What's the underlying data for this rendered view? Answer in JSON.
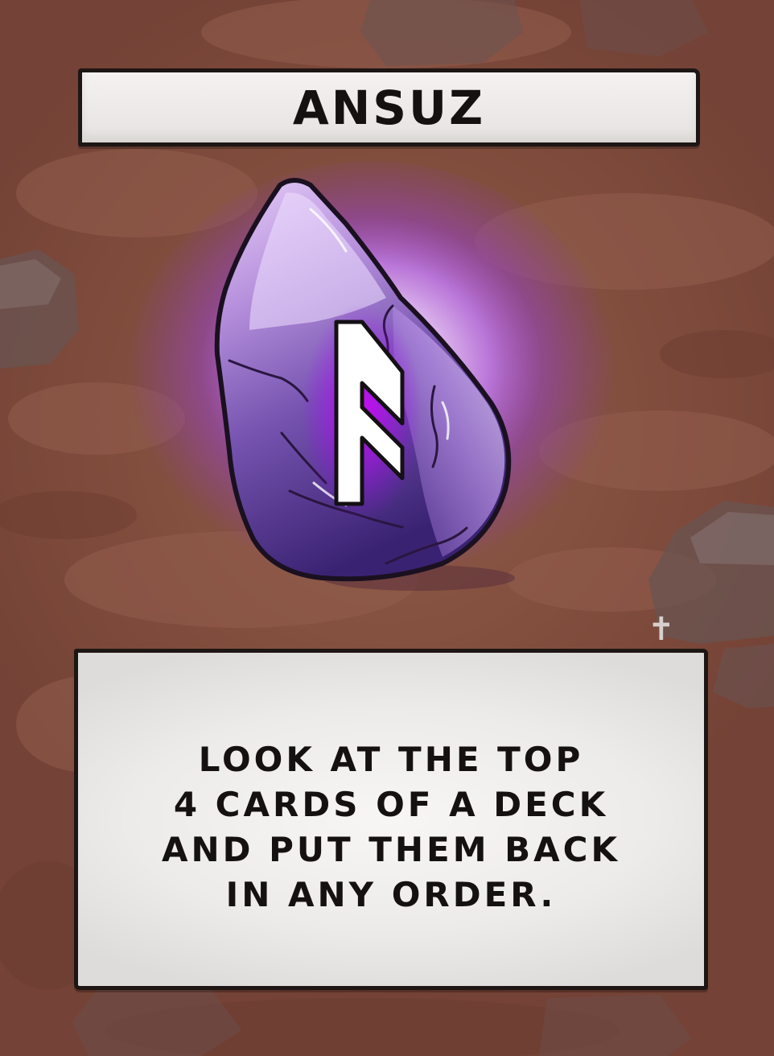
{
  "card": {
    "title": "ANSUZ",
    "rune_symbol": "rune-ansuz-icon",
    "description_lines": [
      "LOOK AT THE TOP",
      "4 CARDS OF A DECK",
      "AND PUT THEM BACK",
      "IN ANY ORDER."
    ],
    "mark_glyph": "✝"
  },
  "colors": {
    "background": "#7f4a40",
    "banner": "#f0eeed",
    "outline": "#1e1614",
    "stone_light": "#d6b8ec",
    "stone_dark": "#3a2272",
    "glow": "#a34df0",
    "rune": "#ffffff"
  }
}
